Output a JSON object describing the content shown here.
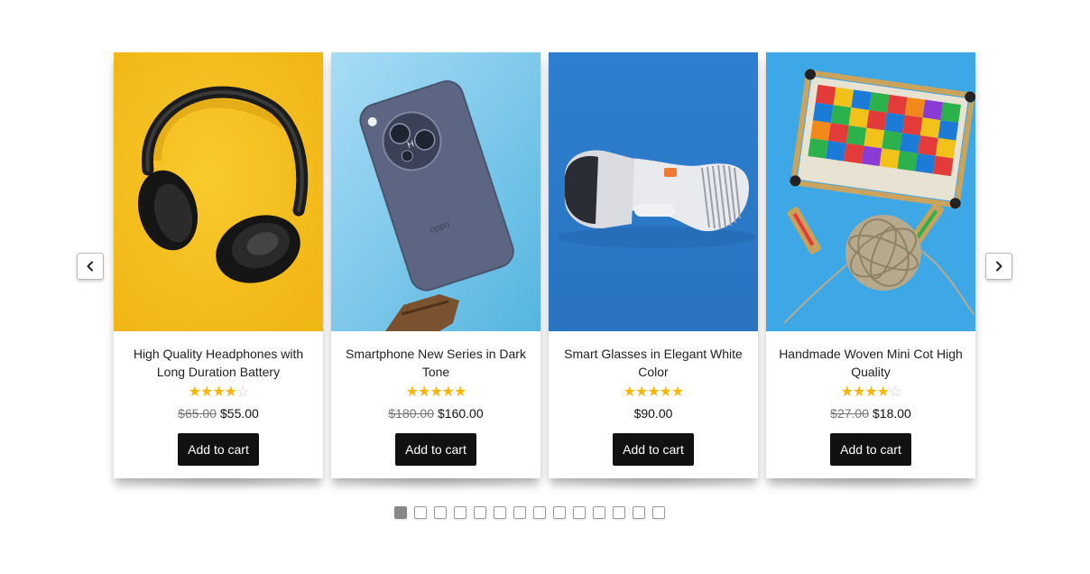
{
  "carousel": {
    "prev_icon": "chevron-left-icon",
    "next_icon": "chevron-right-icon",
    "products": [
      {
        "title": "High Quality Headphones with Long Duration Battery",
        "rating": 4,
        "rating_max": 5,
        "old_price": "$65.00",
        "price": "$55.00",
        "button": "Add to cart",
        "image": "headphones-image",
        "bg_color": "#f7c11f"
      },
      {
        "title": "Smartphone New Series in Dark Tone",
        "rating": 5,
        "rating_max": 5,
        "old_price": "$180.00",
        "price": "$160.00",
        "button": "Add to cart",
        "image": "smartphone-image",
        "bg_color": "#7fc8ea"
      },
      {
        "title": "Smart Glasses in Elegant White Color",
        "rating": 5,
        "rating_max": 5,
        "old_price": "",
        "price": "$90.00",
        "button": "Add to cart",
        "image": "vr-headset-image",
        "bg_color": "#2f7fcf"
      },
      {
        "title": "Handmade Woven Mini Cot High Quality",
        "rating": 4,
        "rating_max": 5,
        "old_price": "$27.00",
        "price": "$18.00",
        "button": "Add to cart",
        "image": "woven-cot-image",
        "bg_color": "#3ea6e6"
      }
    ],
    "pagination": {
      "total": 14,
      "active": 1
    },
    "colors": {
      "star": "#f6b60a",
      "button_bg": "#111111",
      "active_dot": "#888888"
    }
  }
}
